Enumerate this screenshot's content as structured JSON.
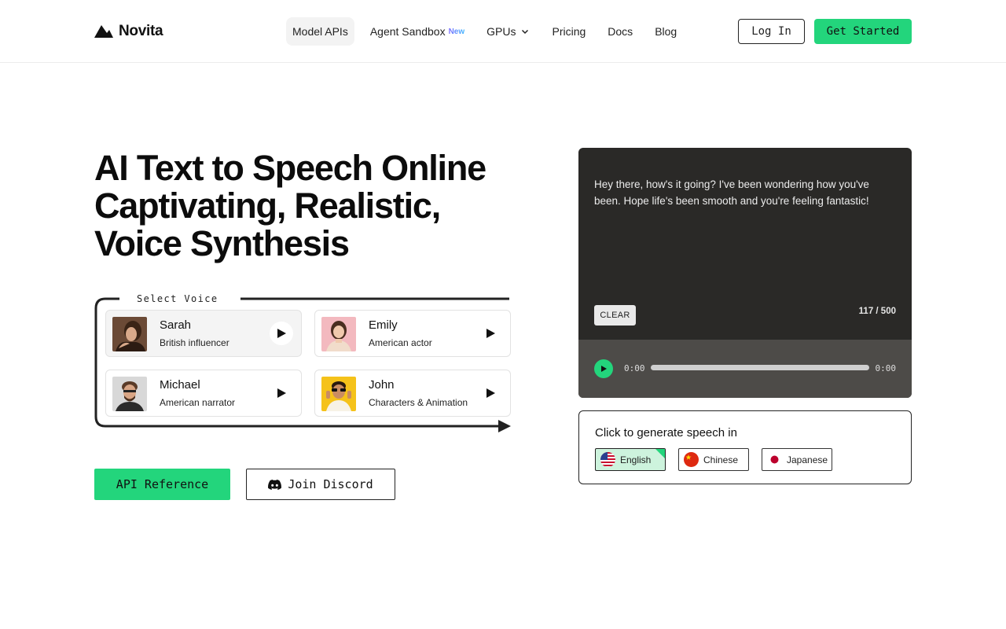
{
  "header": {
    "logo_text": "Novita",
    "nav": [
      {
        "label": "Model APIs",
        "active": true
      },
      {
        "label": "Agent Sandbox",
        "badge": "New"
      },
      {
        "label": "GPUs",
        "has_dropdown": true
      },
      {
        "label": "Pricing"
      },
      {
        "label": "Docs"
      },
      {
        "label": "Blog"
      }
    ],
    "login_label": "Log In",
    "get_started_label": "Get Started"
  },
  "hero": {
    "title_lines": [
      "AI Text to Speech Online",
      "Captivating, Realistic,",
      "Voice Synthesis"
    ]
  },
  "voice_selector": {
    "label": "Select Voice",
    "voices": [
      {
        "name": "Sarah",
        "description": "British influencer",
        "selected": true
      },
      {
        "name": "Emily",
        "description": "American actor",
        "selected": false
      },
      {
        "name": "Michael",
        "description": "American narrator",
        "selected": false
      },
      {
        "name": "John",
        "description": "Characters & Animation",
        "selected": false
      }
    ]
  },
  "actions": {
    "api_reference_label": "API Reference",
    "join_discord_label": "Join Discord"
  },
  "player": {
    "text": "Hey there, how's it going? I've been wondering how you've been. Hope life's been smooth and you're feeling fantastic!",
    "clear_label": "CLEAR",
    "char_count": "117 / 500",
    "time_current": "0:00",
    "time_total": "0:00",
    "progress": 0
  },
  "languages": {
    "title": "Click to generate speech in",
    "options": [
      {
        "label": "English",
        "selected": true,
        "flag": "us-flag"
      },
      {
        "label": "Chinese",
        "selected": false,
        "flag": "cn-flag"
      },
      {
        "label": "Japanese",
        "selected": false,
        "flag": "jp-flag"
      }
    ]
  },
  "colors": {
    "accent": "#23d57c",
    "panel_bg": "#2a2927",
    "audio_bar_bg": "#4d4b48"
  }
}
